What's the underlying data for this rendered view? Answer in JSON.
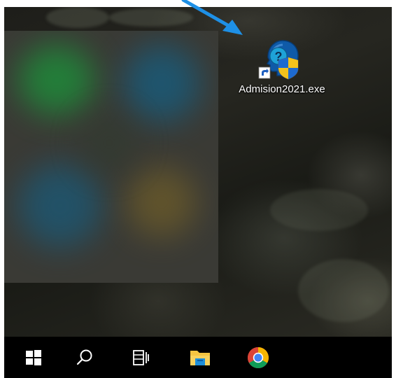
{
  "desktop": {
    "icons": [
      {
        "label": "Admision2021.exe",
        "icon": "blue-head-question-mark-with-uac-shield-icon",
        "shortcut": true
      }
    ],
    "annotation": {
      "icon": "blue-arrow-pointer",
      "color": "#1e90e6"
    }
  },
  "taskbar": {
    "items": [
      {
        "name": "start",
        "icon": "windows-logo-icon"
      },
      {
        "name": "search",
        "icon": "search-icon"
      },
      {
        "name": "task-view",
        "icon": "task-view-icon"
      },
      {
        "name": "file-explorer",
        "icon": "folder-icon"
      },
      {
        "name": "chrome",
        "icon": "chrome-icon"
      }
    ]
  },
  "colors": {
    "taskbar": "#000000",
    "arrow": "#1e90e6",
    "folder": "#f5c542",
    "app_blue": "#0f5aa8"
  }
}
